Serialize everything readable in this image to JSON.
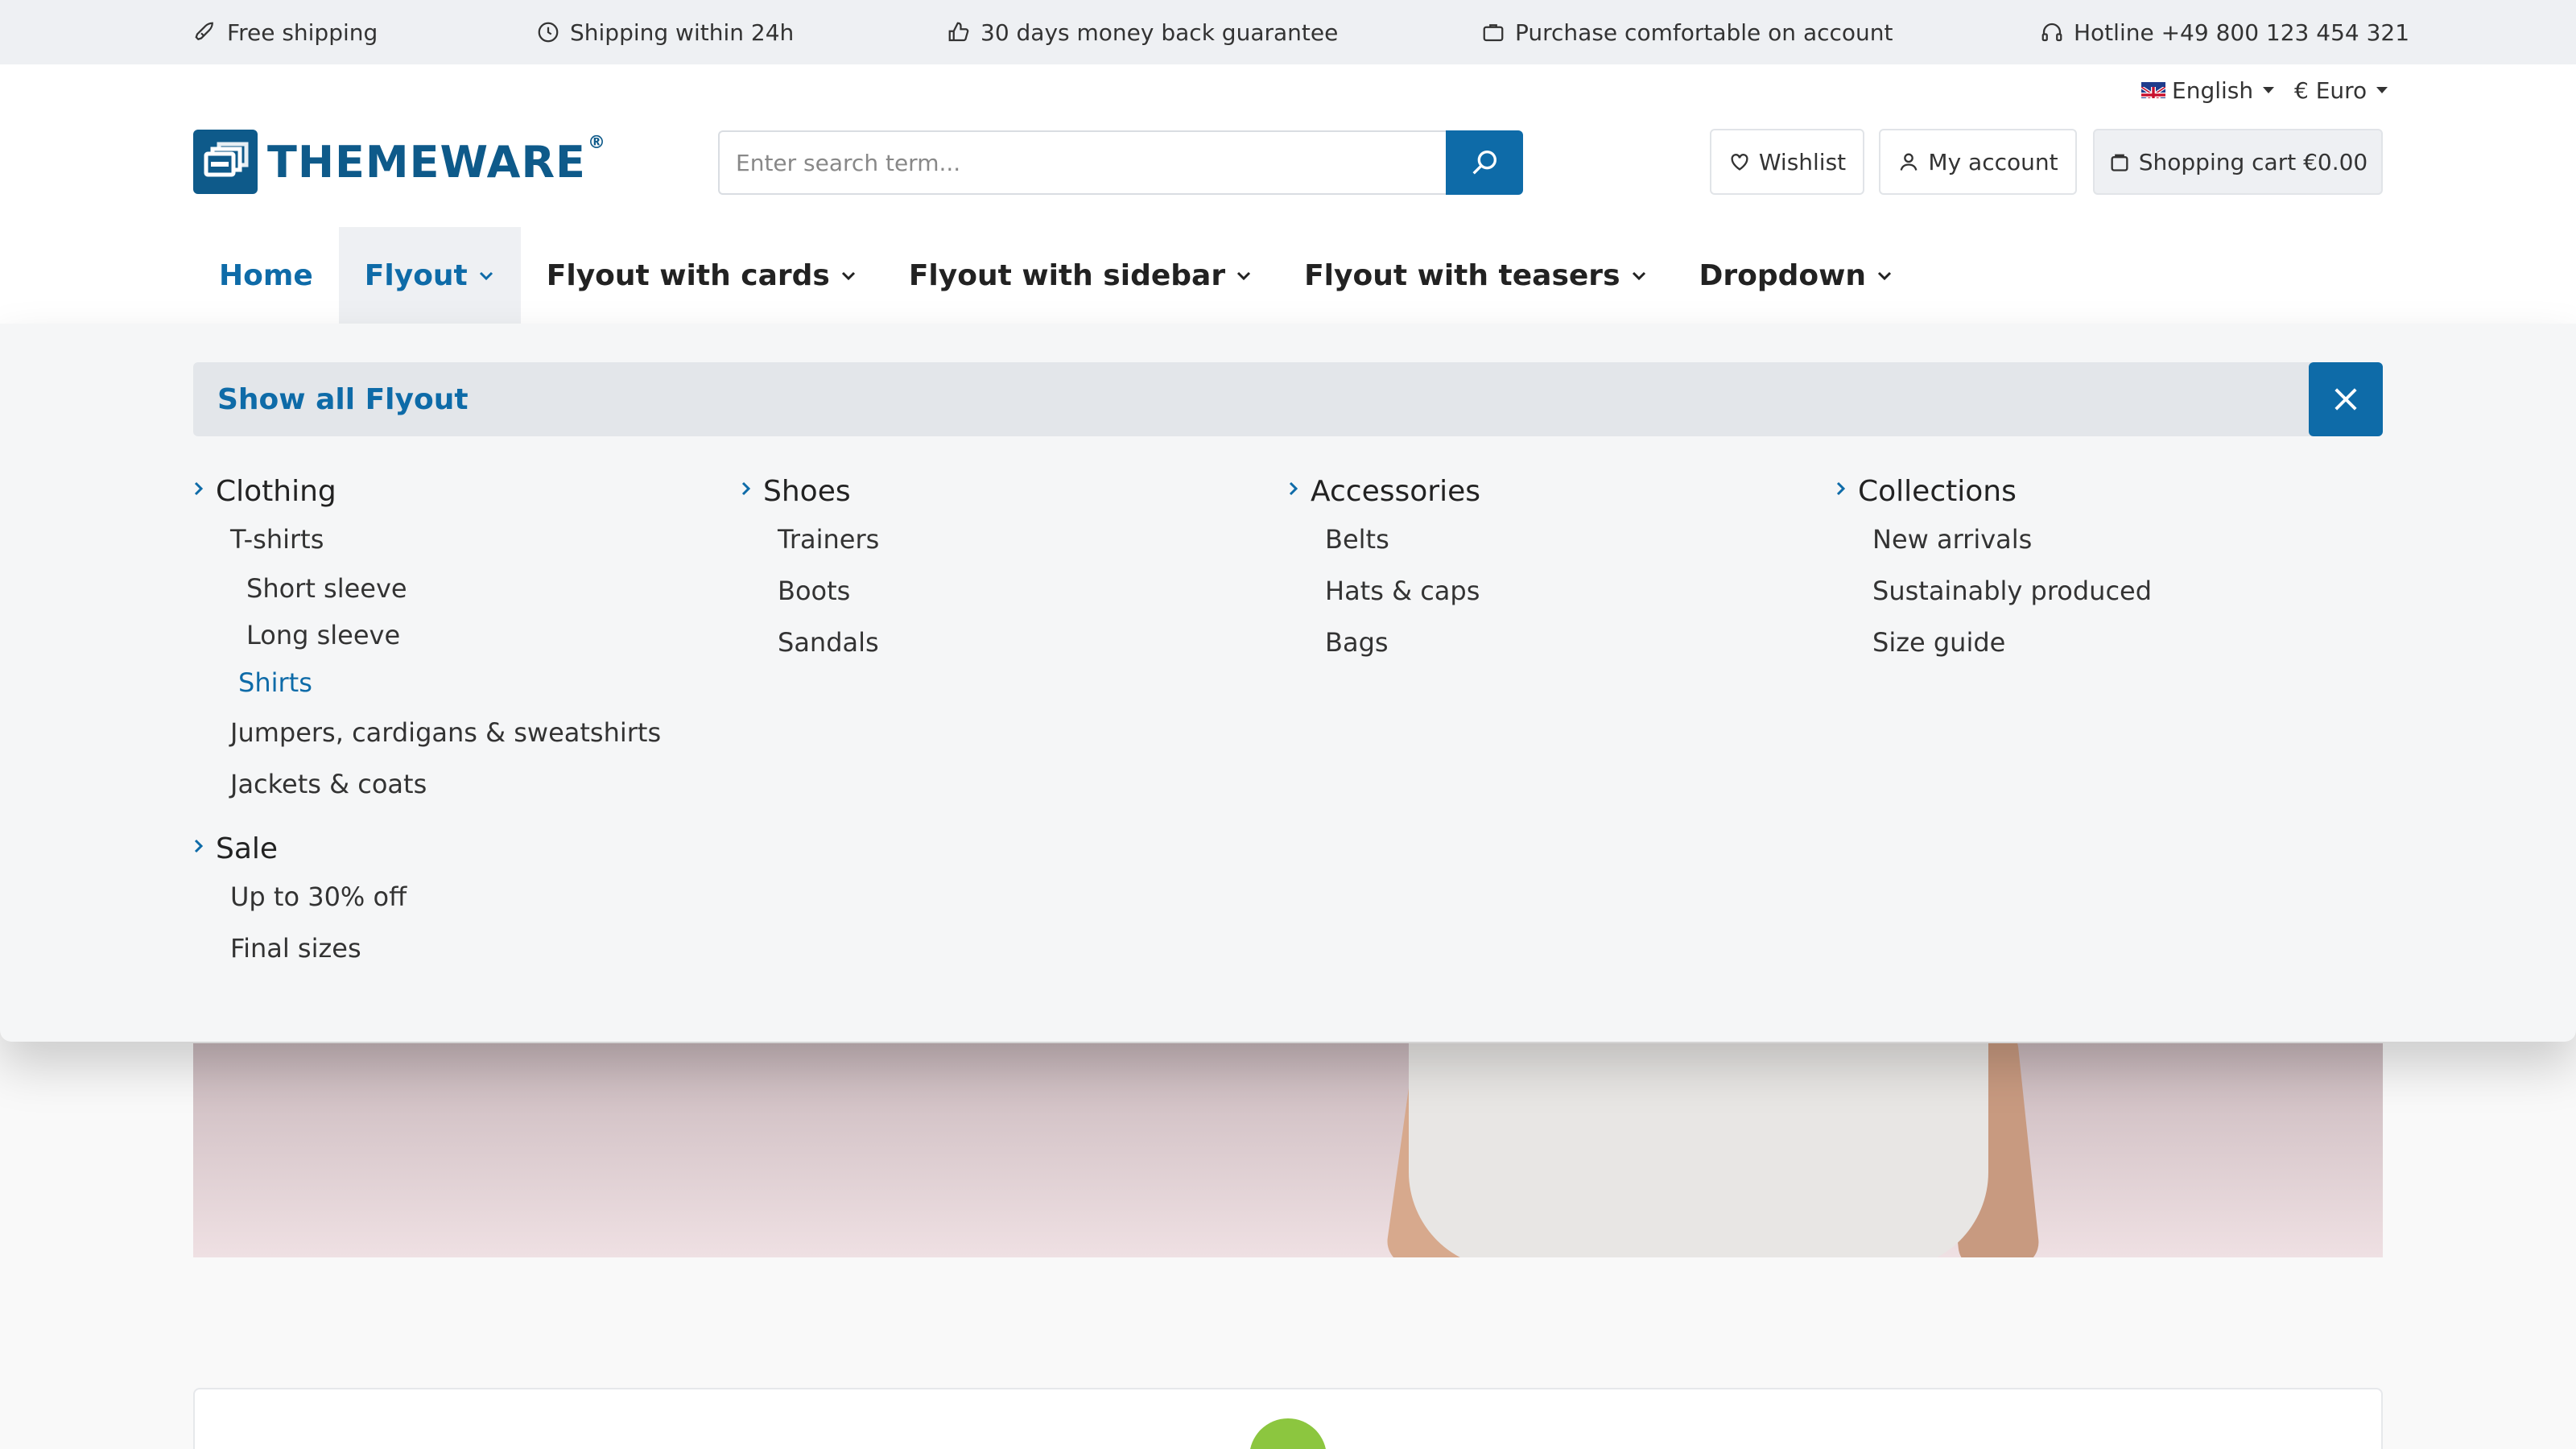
{
  "usp_bar": {
    "items": [
      {
        "icon": "rocket-icon",
        "label": "Free shipping"
      },
      {
        "icon": "clock-icon",
        "label": "Shipping within 24h"
      },
      {
        "icon": "thumbs-up-icon",
        "label": "30 days money back guarantee"
      },
      {
        "icon": "briefcase-icon",
        "label": "Purchase comfortable on account"
      },
      {
        "icon": "headset-icon",
        "label": "Hotline +49 800 123 454 321"
      }
    ]
  },
  "header": {
    "language": "English",
    "currency": "€ Euro",
    "logo_text": "THEMEWARE",
    "logo_mark": "®",
    "search": {
      "placeholder": "Enter search term...",
      "value": ""
    },
    "wishlist_label": "Wishlist",
    "account_label": "My account",
    "cart_label": "Shopping cart €0.00"
  },
  "nav": {
    "items": [
      {
        "label": "Home"
      },
      {
        "label": "Flyout"
      },
      {
        "label": "Flyout with cards"
      },
      {
        "label": "Flyout with sidebar"
      },
      {
        "label": "Flyout with teasers"
      },
      {
        "label": "Dropdown"
      }
    ],
    "active_item": "Flyout"
  },
  "flyout": {
    "show_all_label": "Show all Flyout",
    "columns": [
      {
        "groups": [
          {
            "title": "Clothing",
            "items": [
              "T-shirts",
              "Short sleeve",
              "Long sleeve",
              "Shirts",
              "Jumpers, cardigans & sweatshirts",
              "Jackets & coats"
            ]
          },
          {
            "title": "Sale",
            "items": [
              "Up to 30% off",
              "Final sizes"
            ]
          }
        ]
      },
      {
        "groups": [
          {
            "title": "Shoes",
            "items": [
              "Trainers",
              "Boots",
              "Sandals"
            ]
          }
        ]
      },
      {
        "groups": [
          {
            "title": "Accessories",
            "items": [
              "Belts",
              "Hats & caps",
              "Bags"
            ]
          }
        ]
      },
      {
        "groups": [
          {
            "title": "Collections",
            "items": [
              "New arrivals",
              "Sustainably produced",
              "Size guide"
            ]
          }
        ]
      }
    ]
  },
  "colors": {
    "primary": "#0e6ba8",
    "topbar_bg": "#eef0f3",
    "flyout_bg": "#f5f6f7",
    "accent_green": "#8cc63f"
  }
}
